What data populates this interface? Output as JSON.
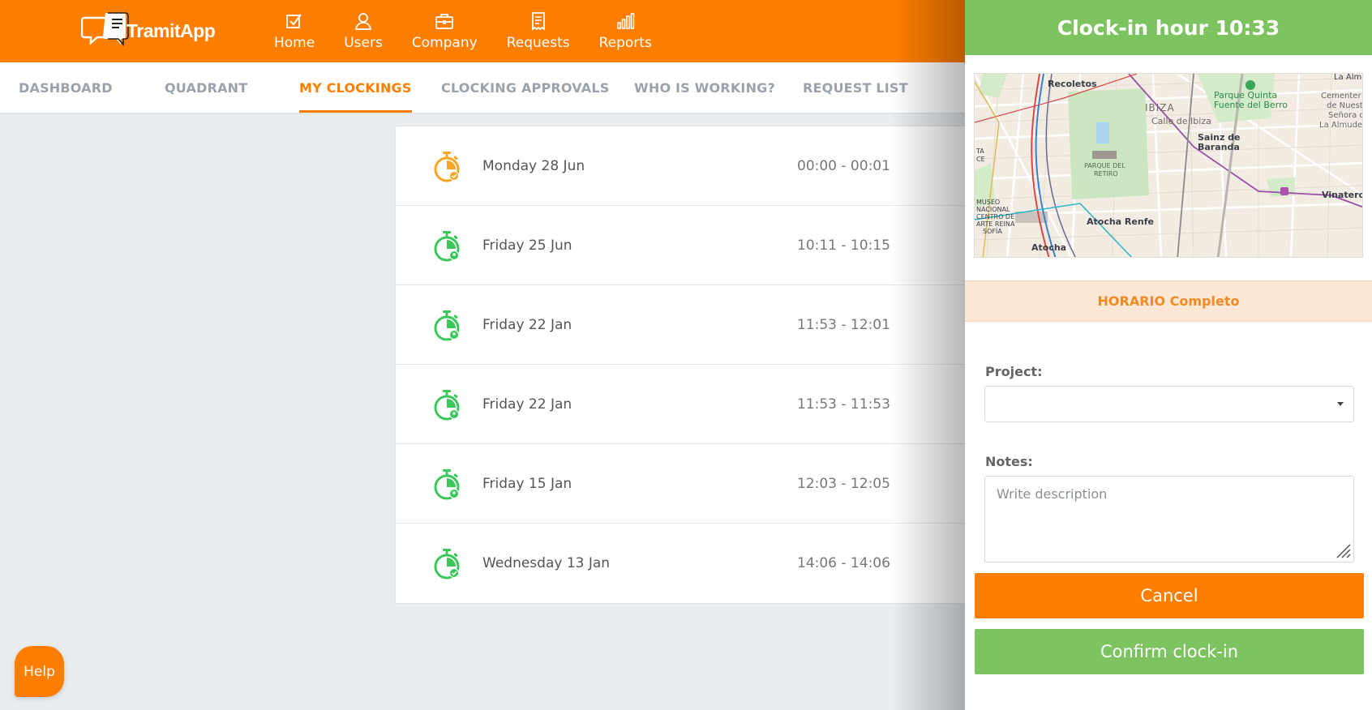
{
  "brand": {
    "name_part1": "Tramit",
    "name_part2": "App"
  },
  "colors": {
    "primary": "#ff7e00",
    "success": "#7dc460",
    "background": "#e9edf0",
    "notice_bg": "#fde8d6",
    "notice_text": "#f08a24"
  },
  "nav": [
    {
      "label": "Home",
      "icon": "checkbox-icon"
    },
    {
      "label": "Users",
      "icon": "user-icon"
    },
    {
      "label": "Company",
      "icon": "briefcase-icon"
    },
    {
      "label": "Requests",
      "icon": "receipt-icon"
    },
    {
      "label": "Reports",
      "icon": "bar-chart-icon"
    }
  ],
  "tabs": [
    {
      "label": "DASHBOARD",
      "active": false
    },
    {
      "label": "QUADRANT",
      "active": false
    },
    {
      "label": "MY CLOCKINGS",
      "active": true
    },
    {
      "label": "CLOCKING APPROVALS",
      "active": false
    },
    {
      "label": "WHO IS WORKING?",
      "active": false
    },
    {
      "label": "REQUEST LIST",
      "active": false
    }
  ],
  "clockings": [
    {
      "date": "Monday 28 Jun",
      "time": "00:00 - 00:01",
      "status": "pending",
      "color": "#f5a623"
    },
    {
      "date": "Friday 25 Jun",
      "time": "10:11 - 10:15",
      "status": "location",
      "color": "#3cc75a"
    },
    {
      "date": "Friday 22 Jan",
      "time": "11:53 - 12:01",
      "status": "location",
      "color": "#3cc75a"
    },
    {
      "date": "Friday 22 Jan",
      "time": "11:53 - 11:53",
      "status": "location",
      "color": "#3cc75a"
    },
    {
      "date": "Friday 15 Jan",
      "time": "12:03 - 12:05",
      "status": "location",
      "color": "#3cc75a"
    },
    {
      "date": "Wednesday 13 Jan",
      "time": "14:06 - 14:06",
      "status": "approved",
      "color": "#3cc75a"
    }
  ],
  "panel": {
    "title": "Clock-in hour 10:33",
    "schedule": "HORARIO Completo",
    "project_label": "Project:",
    "project_value": "",
    "notes_label": "Notes:",
    "notes_placeholder": "Write description",
    "cancel_label": "Cancel",
    "confirm_label": "Confirm clock-in"
  },
  "map": {
    "labels": {
      "recoletos": "Recoletos",
      "parque_quinta_1": "Parque Quinta",
      "parque_quinta_2": "Fuente del Berro",
      "ibiza": "IBIZA",
      "calle_ibiza": "Calle de Ibiza",
      "sainz_1": "Sainz de",
      "sainz_2": "Baranda",
      "retiro_1": "PARQUE DEL",
      "retiro_2": "RETIRO",
      "museo_1": "MUSEO",
      "museo_2": "NACIONAL",
      "museo_3": "CENTRO DE",
      "museo_4": "ARTE REINA",
      "museo_5": "SOFÍA",
      "atocha_renfe": "Atocha Renfe",
      "atocha": "Atocha",
      "vinateros": "Vinateros",
      "la_alm": "La Alm",
      "cementerio_1": "Cementer",
      "cementerio_2": "de Nuest",
      "cementerio_3": "Señora d",
      "cementerio_4": "La Almuder",
      "ta": "TA",
      "ce": "CE"
    }
  },
  "help_label": "Help"
}
